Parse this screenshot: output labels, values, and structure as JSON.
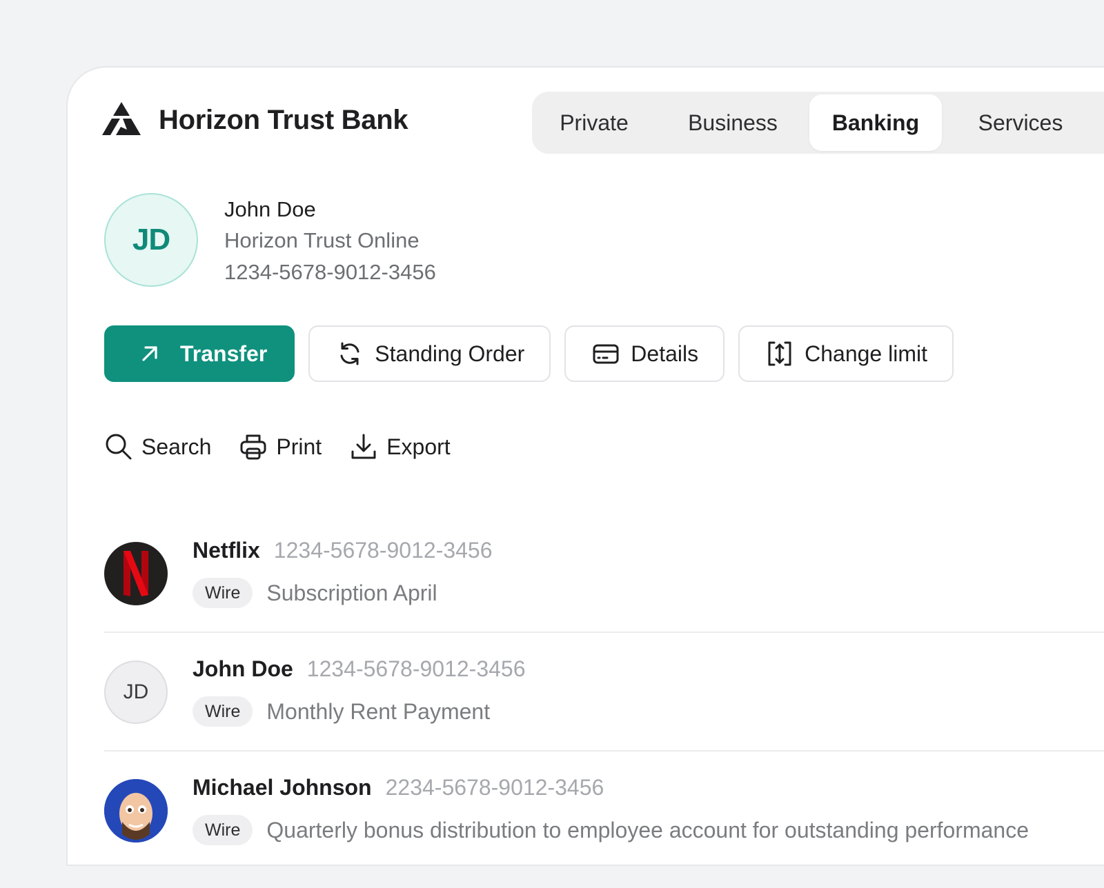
{
  "brand": {
    "name": "Horizon Trust Bank",
    "logo_icon": "mountain-logo-icon"
  },
  "nav": {
    "tabs": [
      {
        "label": "Private",
        "active": false
      },
      {
        "label": "Business",
        "active": false
      },
      {
        "label": "Banking",
        "active": true
      },
      {
        "label": "Services",
        "active": false
      }
    ]
  },
  "profile": {
    "initials": "JD",
    "name": "John Doe",
    "subtitle": "Horizon Trust Online",
    "account": "1234-5678-9012-3456"
  },
  "actions": {
    "transfer": "Transfer",
    "standing_order": "Standing Order",
    "details": "Details",
    "change_limit": "Change limit"
  },
  "tools": {
    "search": "Search",
    "print": "Print",
    "export": "Export"
  },
  "transactions": [
    {
      "name": "Netflix",
      "account": "1234-5678-9012-3456",
      "type": "Wire",
      "description": "Subscription April",
      "avatar": "netflix-logo"
    },
    {
      "name": "John Doe",
      "account": "1234-5678-9012-3456",
      "type": "Wire",
      "description": "Monthly Rent Payment",
      "avatar": "initials",
      "initials": "JD"
    },
    {
      "name": "Michael Johnson",
      "account": "2234-5678-9012-3456",
      "type": "Wire",
      "description": "Quarterly bonus distribution to employee account for outstanding performance",
      "avatar": "photo"
    }
  ],
  "colors": {
    "accent": "#0f917e",
    "background": "#f2f3f5",
    "card": "#ffffff"
  }
}
